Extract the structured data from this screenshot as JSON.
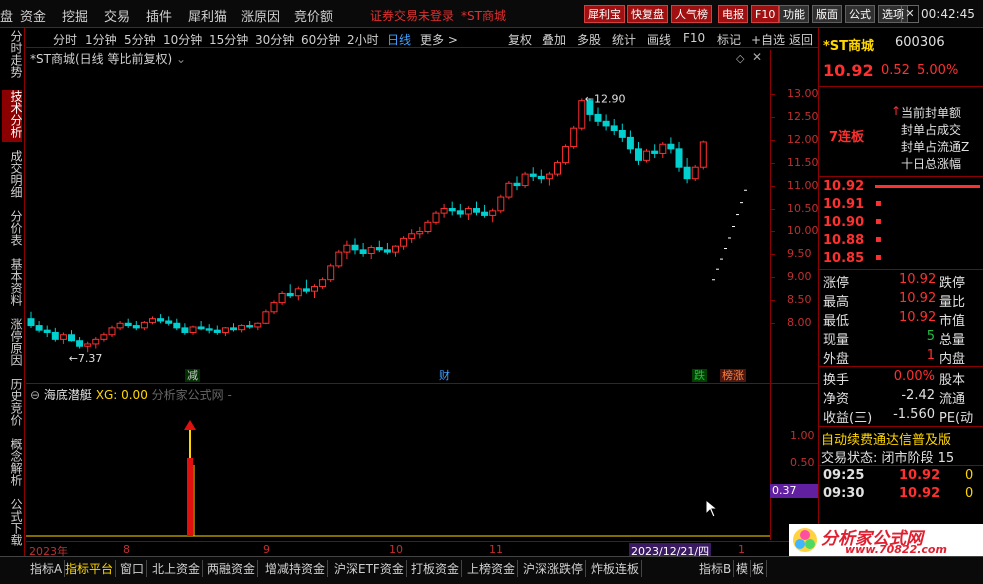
{
  "menu": {
    "items": [
      "盘",
      "资金",
      "挖掘",
      "交易",
      "插件",
      "犀利猫",
      "涨原因",
      "竞价额"
    ],
    "warning": "证券交易未登录",
    "stock_tag": "*ST商城",
    "buttons": [
      "犀利宝",
      "快复盘",
      "人气榜",
      "电报",
      "F10",
      "功能",
      "版面",
      "公式",
      "选项"
    ],
    "time": "00:42:45"
  },
  "left_tabs": [
    "分时走势",
    "技术分析",
    "成交明细",
    "分价表",
    "基本资料",
    "涨停原因",
    "历史竞价",
    "概念解析",
    "公式下载"
  ],
  "period_bar": {
    "periods": [
      "分时",
      "1分钟",
      "5分钟",
      "10分钟",
      "15分钟",
      "30分钟",
      "60分钟",
      "2小时",
      "日线",
      "更多 >"
    ],
    "tools": [
      "复权",
      "叠加",
      "多股",
      "统计",
      "画线",
      "F10",
      "标记",
      "+自选",
      "返回"
    ]
  },
  "chart_info": "*ST商城(日线 等比前复权)",
  "indicator": {
    "name": "海底潜艇",
    "xg": "XG: 0.00",
    "source": "分析家公式网 -"
  },
  "events": [
    {
      "label": "减",
      "color": "#20c040"
    },
    {
      "label": "财",
      "color": "#40a0ff"
    },
    {
      "label": "跌",
      "color": "#20c040"
    },
    {
      "label": "榜涨",
      "color": "#ff8040"
    }
  ],
  "indicator_ticks": [
    "1.00",
    "0.50"
  ],
  "indicator_value": "0.37",
  "time_axis": [
    "2023年",
    "8",
    "9",
    "10",
    "11",
    "2023/12/21/四",
    "1"
  ],
  "bottom_tabs": [
    "指标A",
    "指标平台",
    "窗口",
    "北上资金",
    "两融资金",
    "增减持资金",
    "沪深ETF资金",
    "打板资金",
    "上榜资金",
    "沪深涨跌停",
    "炸板连板",
    "指标B",
    "模",
    "板"
  ],
  "watermark": {
    "text": "分析家公式网",
    "url": "www.70822.com"
  },
  "right_panel": {
    "name": "*ST商城",
    "code": "600306",
    "price": "10.92",
    "change": "0.52",
    "pct": "5.00%",
    "limit_tag": "7连板",
    "seal_labels": [
      "当前封单额",
      "封单占成交",
      "封单占流通Z",
      "十日总涨幅"
    ],
    "order_book": [
      {
        "price": "10.92"
      },
      {
        "price": "10.91"
      },
      {
        "price": "10.90"
      },
      {
        "price": "10.88"
      },
      {
        "price": "10.85"
      }
    ],
    "stats": [
      {
        "label": "涨停",
        "value": "10.92",
        "label2": "跌停"
      },
      {
        "label": "最高",
        "value": "10.92",
        "label2": "量比"
      },
      {
        "label": "最低",
        "value": "10.92",
        "label2": "市值"
      },
      {
        "label": "现量",
        "value": "5",
        "label2": "总量"
      },
      {
        "label": "外盘",
        "value": "1",
        "label2": "内盘"
      }
    ],
    "stats2": [
      {
        "label": "换手",
        "value": "0.00%",
        "label2": "股本"
      },
      {
        "label": "净资",
        "value": "-2.42",
        "label2": "流通"
      },
      {
        "label": "收益(三)",
        "value": "-1.560",
        "label2": "PE(动"
      }
    ],
    "marquee": "自动续费通达信普及版",
    "status": "交易状态: 闭市阶段 15",
    "ticks": [
      {
        "time": "09:25",
        "price": "10.92",
        "vol": "0"
      },
      {
        "time": "09:30",
        "price": "10.92",
        "vol": "0"
      }
    ]
  },
  "colors": {
    "up": "#ff3030",
    "down": "#00d0d0",
    "axis": "#8b0000"
  },
  "chart_data": {
    "type": "candlestick",
    "y_axis_ticks": [
      13.0,
      12.5,
      12.0,
      11.5,
      11.0,
      10.5,
      10.0,
      9.5,
      9.0,
      8.5,
      8.0
    ],
    "ylim": [
      7.2,
      13.3
    ],
    "annotations": [
      {
        "label": "12.90",
        "value": 12.9
      },
      {
        "label": "←7.37",
        "value": 7.37
      }
    ],
    "limit_up_marks": [
      10.92,
      10.65,
      10.39,
      10.13,
      9.88,
      9.65,
      9.42,
      9.2,
      8.97
    ],
    "ohlc": [
      [
        8.1,
        8.25,
        7.9,
        7.95
      ],
      [
        7.95,
        8.05,
        7.8,
        7.85
      ],
      [
        7.85,
        7.95,
        7.7,
        7.8
      ],
      [
        7.8,
        7.9,
        7.6,
        7.65
      ],
      [
        7.65,
        7.8,
        7.55,
        7.75
      ],
      [
        7.75,
        7.85,
        7.6,
        7.62
      ],
      [
        7.62,
        7.7,
        7.45,
        7.5
      ],
      [
        7.5,
        7.6,
        7.37,
        7.55
      ],
      [
        7.55,
        7.7,
        7.45,
        7.65
      ],
      [
        7.65,
        7.8,
        7.6,
        7.75
      ],
      [
        7.75,
        7.95,
        7.7,
        7.9
      ],
      [
        7.9,
        8.05,
        7.85,
        8.0
      ],
      [
        8.0,
        8.1,
        7.9,
        7.95
      ],
      [
        7.95,
        8.05,
        7.85,
        7.9
      ],
      [
        7.9,
        8.05,
        7.85,
        8.02
      ],
      [
        8.02,
        8.15,
        7.98,
        8.1
      ],
      [
        8.1,
        8.2,
        8.0,
        8.05
      ],
      [
        8.05,
        8.15,
        7.95,
        8.0
      ],
      [
        8.0,
        8.1,
        7.85,
        7.9
      ],
      [
        7.9,
        8.0,
        7.75,
        7.8
      ],
      [
        7.8,
        7.95,
        7.75,
        7.92
      ],
      [
        7.92,
        8.05,
        7.85,
        7.88
      ],
      [
        7.88,
        7.98,
        7.78,
        7.85
      ],
      [
        7.85,
        7.95,
        7.75,
        7.8
      ],
      [
        7.8,
        7.92,
        7.72,
        7.9
      ],
      [
        7.9,
        8.0,
        7.82,
        7.86
      ],
      [
        7.86,
        7.98,
        7.8,
        7.95
      ],
      [
        7.95,
        8.05,
        7.88,
        7.92
      ],
      [
        7.92,
        8.02,
        7.85,
        8.0
      ],
      [
        8.0,
        8.3,
        7.98,
        8.25
      ],
      [
        8.25,
        8.5,
        8.2,
        8.45
      ],
      [
        8.45,
        8.7,
        8.4,
        8.65
      ],
      [
        8.65,
        8.85,
        8.55,
        8.6
      ],
      [
        8.6,
        8.8,
        8.5,
        8.75
      ],
      [
        8.75,
        8.95,
        8.65,
        8.7
      ],
      [
        8.7,
        8.85,
        8.55,
        8.8
      ],
      [
        8.8,
        9.0,
        8.75,
        8.95
      ],
      [
        8.95,
        9.3,
        8.9,
        9.25
      ],
      [
        9.25,
        9.6,
        9.2,
        9.55
      ],
      [
        9.55,
        9.8,
        9.4,
        9.7
      ],
      [
        9.7,
        9.85,
        9.5,
        9.6
      ],
      [
        9.6,
        9.75,
        9.45,
        9.52
      ],
      [
        9.52,
        9.7,
        9.4,
        9.65
      ],
      [
        9.65,
        9.8,
        9.55,
        9.6
      ],
      [
        9.6,
        9.75,
        9.5,
        9.55
      ],
      [
        9.55,
        9.7,
        9.45,
        9.68
      ],
      [
        9.68,
        9.9,
        9.6,
        9.85
      ],
      [
        9.85,
        10.05,
        9.75,
        9.95
      ],
      [
        9.95,
        10.1,
        9.85,
        10.0
      ],
      [
        10.0,
        10.25,
        9.95,
        10.2
      ],
      [
        10.2,
        10.45,
        10.15,
        10.4
      ],
      [
        10.4,
        10.6,
        10.3,
        10.5
      ],
      [
        10.5,
        10.65,
        10.35,
        10.45
      ],
      [
        10.45,
        10.6,
        10.3,
        10.38
      ],
      [
        10.38,
        10.55,
        10.25,
        10.5
      ],
      [
        10.5,
        10.65,
        10.35,
        10.42
      ],
      [
        10.42,
        10.58,
        10.3,
        10.35
      ],
      [
        10.35,
        10.5,
        10.2,
        10.45
      ],
      [
        10.45,
        10.8,
        10.4,
        10.75
      ],
      [
        10.75,
        11.1,
        10.7,
        11.05
      ],
      [
        11.05,
        11.2,
        10.9,
        11.0
      ],
      [
        11.0,
        11.3,
        10.95,
        11.25
      ],
      [
        11.25,
        11.4,
        11.1,
        11.2
      ],
      [
        11.2,
        11.35,
        11.05,
        11.15
      ],
      [
        11.15,
        11.3,
        11.0,
        11.25
      ],
      [
        11.25,
        11.55,
        11.2,
        11.5
      ],
      [
        11.5,
        11.9,
        11.45,
        11.85
      ],
      [
        11.85,
        12.3,
        11.8,
        12.25
      ],
      [
        12.25,
        12.9,
        12.2,
        12.85
      ],
      [
        12.85,
        12.9,
        12.4,
        12.55
      ],
      [
        12.55,
        12.7,
        12.3,
        12.4
      ],
      [
        12.4,
        12.55,
        12.2,
        12.3
      ],
      [
        12.3,
        12.45,
        12.1,
        12.2
      ],
      [
        12.2,
        12.35,
        11.95,
        12.05
      ],
      [
        12.05,
        12.2,
        11.7,
        11.8
      ],
      [
        11.8,
        11.95,
        11.45,
        11.55
      ],
      [
        11.55,
        11.8,
        11.5,
        11.75
      ],
      [
        11.75,
        11.9,
        11.6,
        11.7
      ],
      [
        11.7,
        11.95,
        11.6,
        11.9
      ],
      [
        11.9,
        12.05,
        11.7,
        11.8
      ],
      [
        11.8,
        11.95,
        11.3,
        11.4
      ],
      [
        11.4,
        11.6,
        11.05,
        11.15
      ],
      [
        11.15,
        11.45,
        11.1,
        11.4
      ],
      [
        11.4,
        11.98,
        11.35,
        11.95
      ]
    ]
  },
  "indicator_chart": {
    "signal": {
      "value": 1.0
    }
  }
}
